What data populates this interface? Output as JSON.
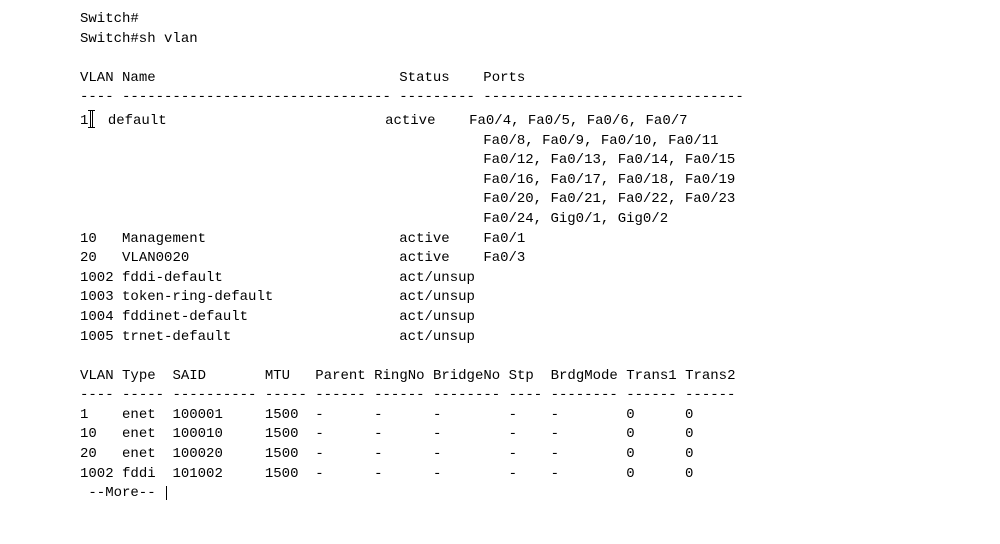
{
  "prompt_lines": {
    "line1": "Switch#",
    "line2": "Switch#sh vlan"
  },
  "table1_header": {
    "vlan": "VLAN",
    "name": "Name",
    "status": "Status",
    "ports": "Ports"
  },
  "table1_div": {
    "c1": "----",
    "c2": "--------------------------------",
    "c3": "---------",
    "c4": "-------------------------------"
  },
  "vlan_brief": [
    {
      "id": "1",
      "name": "default",
      "status": "active",
      "ports": [
        "Fa0/4, Fa0/5, Fa0/6, Fa0/7",
        "Fa0/8, Fa0/9, Fa0/10, Fa0/11",
        "Fa0/12, Fa0/13, Fa0/14, Fa0/15",
        "Fa0/16, Fa0/17, Fa0/18, Fa0/19",
        "Fa0/20, Fa0/21, Fa0/22, Fa0/23",
        "Fa0/24, Gig0/1, Gig0/2"
      ]
    },
    {
      "id": "10",
      "name": "Management",
      "status": "active",
      "ports": [
        "Fa0/1"
      ]
    },
    {
      "id": "20",
      "name": "VLAN0020",
      "status": "active",
      "ports": [
        "Fa0/3"
      ]
    },
    {
      "id": "1002",
      "name": "fddi-default",
      "status": "act/unsup",
      "ports": []
    },
    {
      "id": "1003",
      "name": "token-ring-default",
      "status": "act/unsup",
      "ports": []
    },
    {
      "id": "1004",
      "name": "fddinet-default",
      "status": "act/unsup",
      "ports": []
    },
    {
      "id": "1005",
      "name": "trnet-default",
      "status": "act/unsup",
      "ports": []
    }
  ],
  "table2_header": {
    "vlan": "VLAN",
    "type": "Type",
    "said": "SAID",
    "mtu": "MTU",
    "parent": "Parent",
    "ringno": "RingNo",
    "bridgeno": "BridgeNo",
    "stp": "Stp",
    "brdgmode": "BrdgMode",
    "trans1": "Trans1",
    "trans2": "Trans2"
  },
  "table2_div": {
    "c1": "----",
    "c2": "-----",
    "c3": "----------",
    "c4": "-----",
    "c5": "------",
    "c6": "------",
    "c7": "--------",
    "c8": "----",
    "c9": "--------",
    "c10": "------",
    "c11": "------"
  },
  "vlan_detail": [
    {
      "vlan": "1",
      "type": "enet",
      "said": "100001",
      "mtu": "1500",
      "parent": "-",
      "ringno": "-",
      "bridgeno": "-",
      "stp": "-",
      "brdgmode": "-",
      "trans1": "0",
      "trans2": "0"
    },
    {
      "vlan": "10",
      "type": "enet",
      "said": "100010",
      "mtu": "1500",
      "parent": "-",
      "ringno": "-",
      "bridgeno": "-",
      "stp": "-",
      "brdgmode": "-",
      "trans1": "0",
      "trans2": "0"
    },
    {
      "vlan": "20",
      "type": "enet",
      "said": "100020",
      "mtu": "1500",
      "parent": "-",
      "ringno": "-",
      "bridgeno": "-",
      "stp": "-",
      "brdgmode": "-",
      "trans1": "0",
      "trans2": "0"
    },
    {
      "vlan": "1002",
      "type": "fddi",
      "said": "101002",
      "mtu": "1500",
      "parent": "-",
      "ringno": "-",
      "bridgeno": "-",
      "stp": "-",
      "brdgmode": "-",
      "trans1": "0",
      "trans2": "0"
    }
  ],
  "more_prompt": " --More-- "
}
